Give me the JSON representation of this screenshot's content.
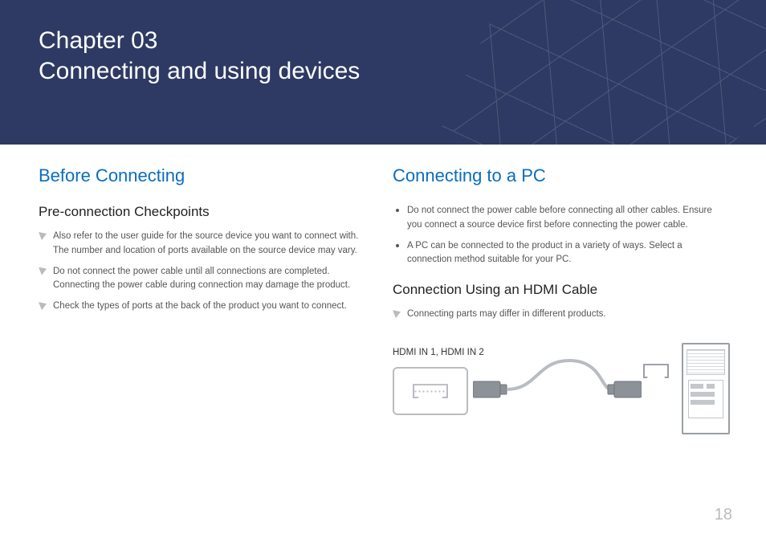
{
  "chapter_label": "Chapter  03",
  "chapter_title": "Connecting and using devices",
  "page_number": "18",
  "left": {
    "heading": "Before Connecting",
    "sub": "Pre-connection Checkpoints",
    "notes": [
      "Also refer to the user guide for the source device you want to connect with. The number and location of ports available on the source device may vary.",
      "Do not connect the power cable until all connections are completed. Connecting the power cable during connection may damage the product.",
      "Check the types of ports at the back of the product you want to connect."
    ]
  },
  "right": {
    "heading": "Connecting to a PC",
    "bullets": [
      "Do not connect the power cable before connecting all other cables. Ensure you connect a source device first before connecting the power cable.",
      "A PC can be connected to the product in a variety of ways. Select a connection method suitable for your PC."
    ],
    "sub": "Connection Using an HDMI Cable",
    "note": "Connecting parts may differ in different products.",
    "diagram_label": "HDMI IN 1, HDMI IN 2"
  }
}
